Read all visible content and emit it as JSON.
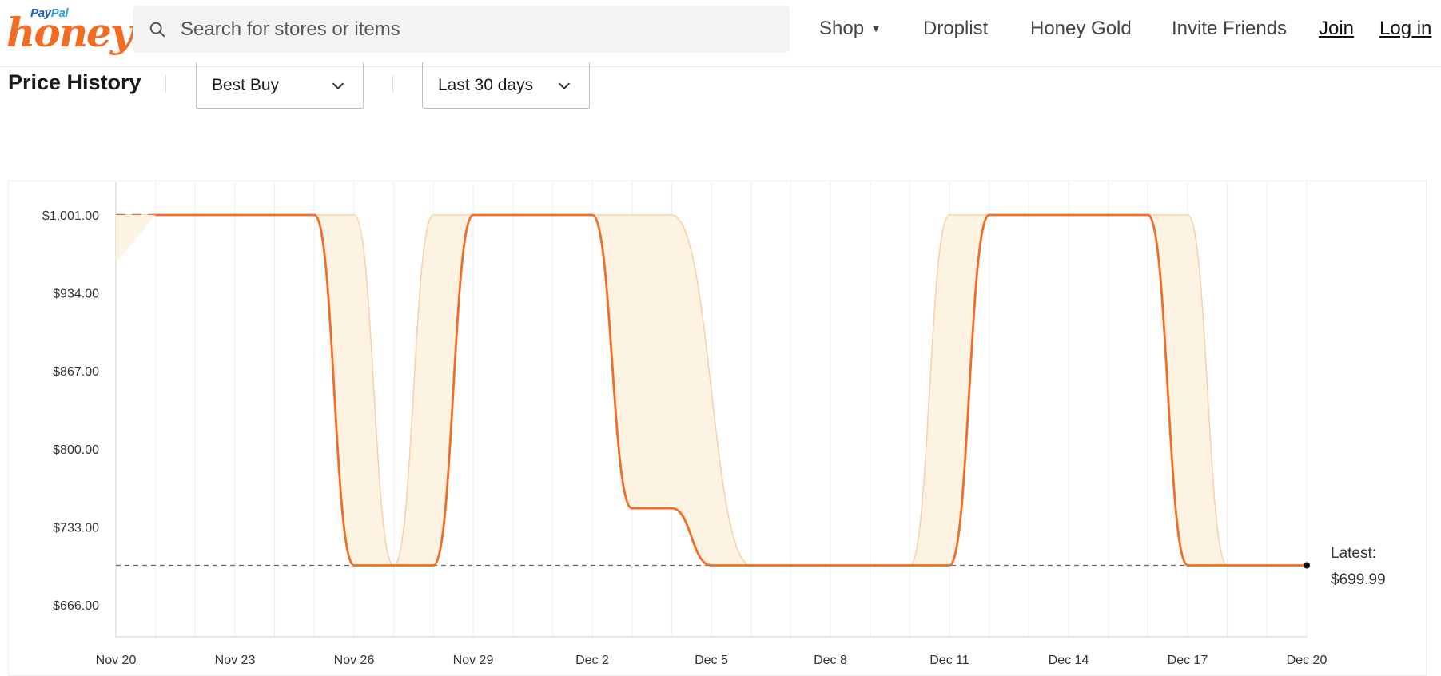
{
  "header": {
    "logo_paypal_a": "Pay",
    "logo_paypal_b": "Pal",
    "logo_honey": "honey",
    "search_placeholder": "Search for stores or items",
    "nav": {
      "shop": "Shop",
      "droplist": "Droplist",
      "honey_gold": "Honey Gold",
      "invite": "Invite Friends",
      "join": "Join",
      "login": "Log in"
    }
  },
  "controls": {
    "title": "Price History",
    "store": "Best Buy",
    "range": "Last 30 days"
  },
  "colors": {
    "accent": "#f26c23",
    "band_fill": "#fdf3e3",
    "band_stroke": "#f8cfa8",
    "grid": "#eeeeee"
  },
  "chart_data": {
    "type": "line",
    "title": "",
    "xlabel": "",
    "ylabel": "",
    "x_ticks": [
      "Nov 20",
      "Nov 23",
      "Nov 26",
      "Nov 29",
      "Dec 2",
      "Dec 5",
      "Dec 8",
      "Dec 11",
      "Dec 14",
      "Dec 17",
      "Dec 20"
    ],
    "y_ticks": [
      "$1,001.00",
      "$934.00",
      "$867.00",
      "$800.00",
      "$733.00",
      "$666.00"
    ],
    "ylim": [
      666,
      1001
    ],
    "xlim_days": [
      0,
      30
    ],
    "grid": "vertical-daily",
    "series": [
      {
        "values": [
          [
            0,
            1001
          ],
          [
            5,
            1001
          ],
          [
            6,
            699.99
          ],
          [
            8,
            699.99
          ],
          [
            9,
            1001
          ],
          [
            12,
            1001
          ],
          [
            13,
            749
          ],
          [
            14,
            749
          ],
          [
            15,
            699.99
          ],
          [
            21,
            699.99
          ],
          [
            22,
            1001
          ],
          [
            26,
            1001
          ],
          [
            27,
            699.99
          ],
          [
            30,
            699.99
          ]
        ]
      }
    ],
    "range_band": {
      "upper": [
        [
          0,
          1001
        ],
        [
          6,
          1001
        ],
        [
          7,
          699.99
        ],
        [
          7,
          699.99
        ],
        [
          8,
          1001
        ],
        [
          14,
          1001
        ],
        [
          16,
          699.99
        ],
        [
          20,
          699.99
        ],
        [
          21,
          1001
        ],
        [
          27,
          1001
        ],
        [
          28,
          699.99
        ],
        [
          30,
          699.99
        ]
      ],
      "lower": [
        [
          0,
          1001
        ],
        [
          5,
          1001
        ],
        [
          6,
          699.99
        ],
        [
          8,
          699.99
        ],
        [
          9,
          1001
        ],
        [
          12,
          1001
        ],
        [
          13,
          749
        ],
        [
          14,
          749
        ],
        [
          15,
          699.99
        ],
        [
          21,
          699.99
        ],
        [
          22,
          1001
        ],
        [
          26,
          1001
        ],
        [
          27,
          699.99
        ],
        [
          30,
          699.99
        ]
      ]
    },
    "reference_line": 699.99,
    "latest_label": "Latest:",
    "latest_value": "$699.99"
  }
}
